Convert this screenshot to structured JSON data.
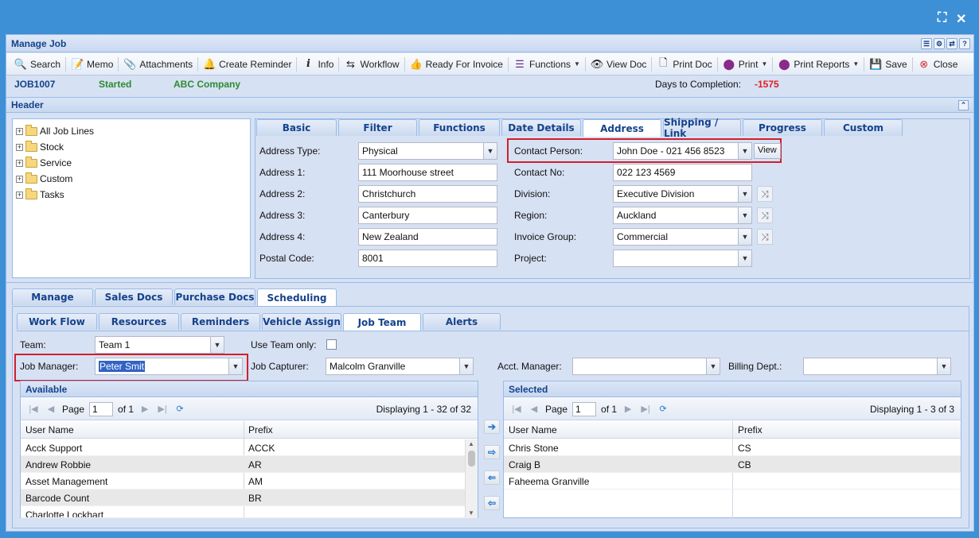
{
  "window_controls": {
    "maximize_icon": "expand-icon",
    "close_icon": "close-x-icon"
  },
  "title": "Manage Job",
  "title_tools": [
    "list-icon",
    "settings-icon",
    "refresh-icon",
    "help-icon"
  ],
  "toolbar": {
    "search": "Search",
    "memo": "Memo",
    "attachments": "Attachments",
    "create_reminder": "Create Reminder",
    "info": "Info",
    "workflow": "Workflow",
    "ready_for_invoice": "Ready For Invoice",
    "functions": "Functions",
    "view_doc": "View Doc",
    "print_doc": "Print Doc",
    "print": "Print",
    "print_reports": "Print Reports",
    "save": "Save",
    "close": "Close"
  },
  "job": {
    "number": "JOB1007",
    "status": "Started",
    "company": "ABC Company",
    "days_label": "Days to Completion:",
    "days_value": "-1575"
  },
  "header_panel": {
    "title": "Header"
  },
  "tree": [
    "All Job Lines",
    "Stock",
    "Service",
    "Custom",
    "Tasks"
  ],
  "top_tabs": [
    "Basic",
    "Filter",
    "Functions",
    "Date Details",
    "Address",
    "Shipping / Link",
    "Progress",
    "Custom"
  ],
  "top_active": "Address",
  "address": {
    "type_label": "Address Type:",
    "type_value": "Physical",
    "a1_label": "Address 1:",
    "a1_value": "111 Moorhouse street",
    "a2_label": "Address 2:",
    "a2_value": "Christchurch",
    "a3_label": "Address 3:",
    "a3_value": "Canterbury",
    "a4_label": "Address 4:",
    "a4_value": "New Zealand",
    "postal_label": "Postal Code:",
    "postal_value": "8001",
    "contact_label": "Contact Person:",
    "contact_value": "John Doe - 021 456 8523",
    "view": "View",
    "contact_no_label": "Contact No:",
    "contact_no_value": "022 123 4569",
    "division_label": "Division:",
    "division_value": "Executive Division",
    "region_label": "Region:",
    "region_value": "Auckland",
    "invoice_label": "Invoice Group:",
    "invoice_value": "Commercial",
    "project_label": "Project:",
    "project_value": ""
  },
  "main_tabs": [
    "Manage",
    "Sales Docs",
    "Purchase Docs",
    "Scheduling"
  ],
  "main_active": "Scheduling",
  "sub_tabs": [
    "Work Flow",
    "Resources",
    "Reminders",
    "Vehicle Assign",
    "Job Team",
    "Alerts"
  ],
  "sub_active": "Job Team",
  "team": {
    "team_label": "Team:",
    "team_value": "Team 1",
    "use_team_only": "Use Team only:",
    "manager_label": "Job Manager:",
    "manager_value": "Peter Smit",
    "capturer_label": "Job Capturer:",
    "capturer_value": "Malcolm Granville",
    "acct_label": "Acct. Manager:",
    "acct_value": "",
    "billing_label": "Billing Dept.:",
    "billing_value": ""
  },
  "available": {
    "title": "Available",
    "page_label": "Page",
    "page": "1",
    "of": "of 1",
    "display": "Displaying 1 - 32 of 32",
    "col_user": "User Name",
    "col_prefix": "Prefix",
    "rows": [
      [
        "Acck Support",
        "ACCK"
      ],
      [
        "Andrew Robbie",
        "AR"
      ],
      [
        "Asset Management",
        "AM"
      ],
      [
        "Barcode Count",
        "BR"
      ],
      [
        "Charlotte Lockhart",
        ""
      ]
    ]
  },
  "selected": {
    "title": "Selected",
    "page_label": "Page",
    "page": "1",
    "of": "of 1",
    "display": "Displaying 1 - 3 of 3",
    "col_user": "User Name",
    "col_prefix": "Prefix",
    "rows": [
      [
        "Chris Stone",
        "CS"
      ],
      [
        "Craig B",
        "CB"
      ],
      [
        "Faheema Granville",
        ""
      ]
    ]
  }
}
